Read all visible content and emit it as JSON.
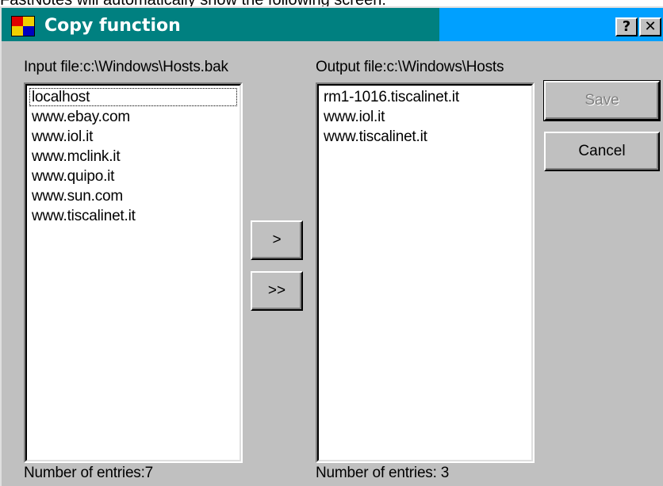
{
  "caption": "FastNotes will automatically show the following screen:",
  "window": {
    "title": "Copy function",
    "help_label": "?",
    "close_label": "✕"
  },
  "input": {
    "label": "Input file:c:\\Windows\\Hosts.bak",
    "items": [
      "localhost",
      "www.ebay.com",
      "www.iol.it",
      "www.mclink.it",
      "www.quipo.it",
      "www.sun.com",
      "www.tiscalinet.it"
    ],
    "count_label": "Number of entries:7"
  },
  "output": {
    "label": "Output file:c:\\Windows\\Hosts",
    "items": [
      "rm1-1016.tiscalinet.it",
      "www.iol.it",
      "www.tiscalinet.it"
    ],
    "count_label": "Number of entries: 3"
  },
  "buttons": {
    "move_one": ">",
    "move_all": ">>",
    "save": "Save",
    "cancel": "Cancel"
  },
  "colors": {
    "titlebar": "#008080",
    "titlebar_right": "#00a0ff",
    "face": "#c0c0c0"
  }
}
